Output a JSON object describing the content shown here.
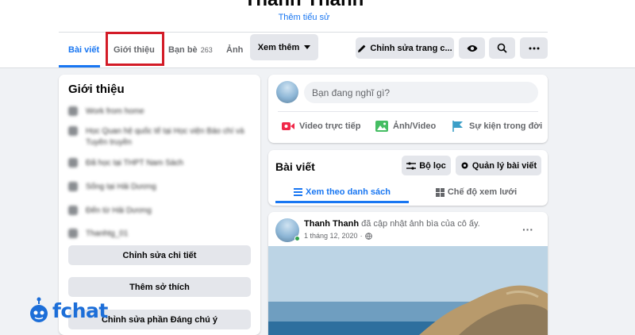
{
  "profile": {
    "name": "Thanh Thanh",
    "add_bio": "Thêm tiểu sử"
  },
  "tabs": [
    {
      "label": "Bài viết"
    },
    {
      "label": "Giới thiệu"
    },
    {
      "label": "Bạn bè",
      "count": "263"
    },
    {
      "label": "Ảnh"
    },
    {
      "label": "Xem thêm"
    }
  ],
  "actions": {
    "edit_page": "Chỉnh sửa trang c..."
  },
  "intro": {
    "title": "Giới thiệu",
    "rows": [
      {
        "text": "Work from home"
      },
      {
        "text": "Học Quan hệ quốc tế tại Học viện Báo chí và Tuyên truyền"
      },
      {
        "text": "Đã học tại THPT Nam Sách"
      },
      {
        "text": "Sống tại Hải Dương"
      },
      {
        "text": "Đến từ Hải Dương"
      },
      {
        "text": "Thanhtg_01"
      }
    ],
    "buttons": {
      "edit_details": "Chỉnh sửa chi tiết",
      "add_hobbies": "Thêm sở thích",
      "edit_featured": "Chỉnh sửa phần Đáng chú ý"
    }
  },
  "composer": {
    "placeholder": "Bạn đang nghĩ gì?",
    "live": "Video trực tiếp",
    "photo": "Ảnh/Video",
    "event": "Sự kiện trong đời"
  },
  "posts": {
    "title": "Bài viết",
    "filter": "Bộ lọc",
    "manage": "Quản lý bài viết",
    "list_view": "Xem theo danh sách",
    "grid_view": "Chế độ xem lưới"
  },
  "post": {
    "author": "Thanh Thanh",
    "action": "đã cập nhật ảnh bìa của cô ấy.",
    "date": "1 tháng 12, 2020",
    "more": "···"
  },
  "logo": {
    "text": "fchat"
  },
  "colors": {
    "accent": "#1876f2",
    "highlight": "#d31b27",
    "logo": "#1c6ed8"
  }
}
